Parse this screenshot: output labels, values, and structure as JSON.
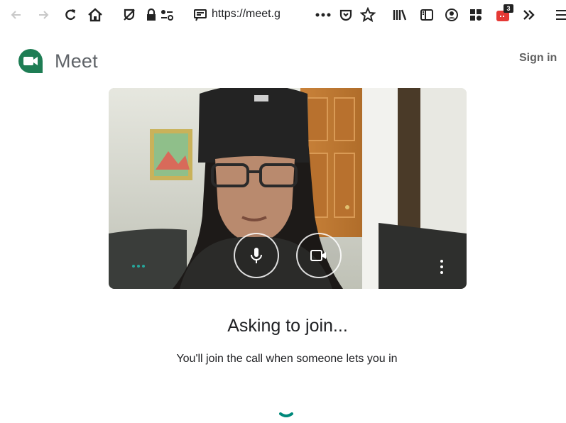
{
  "browser": {
    "url": "https://meet.g",
    "notification_count": "3",
    "icons": [
      "back-icon",
      "forward-icon",
      "reload-icon",
      "home-icon",
      "tracking-protection-icon",
      "lock-icon",
      "permissions-icon",
      "page-action-icon",
      "more-icon",
      "pocket-icon",
      "bookmark-star-icon",
      "library-icon",
      "sidebar-icon",
      "account-icon",
      "extensions-icon",
      "extension-badge-icon",
      "overflow-icon",
      "menu-icon"
    ]
  },
  "header": {
    "brand": "Meet",
    "sign_in": "Sign in"
  },
  "preview": {
    "controls": [
      "microphone-icon",
      "camera-icon"
    ]
  },
  "status": {
    "heading": "Asking to join...",
    "message": "You'll join the call when someone lets you in"
  },
  "colors": {
    "accent": "#00897b",
    "logo_green": "#1e7d54",
    "badge_red": "#e53935"
  }
}
